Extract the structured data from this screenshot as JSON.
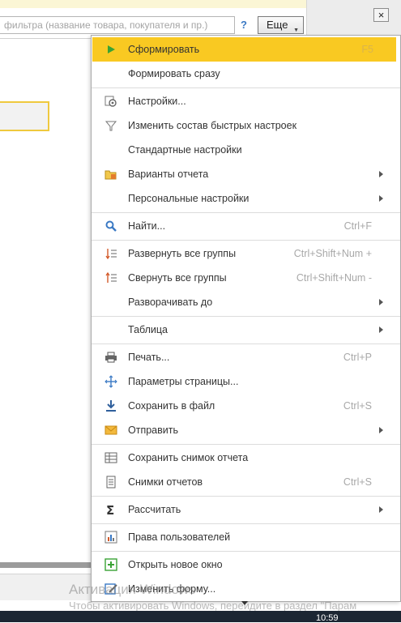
{
  "search": {
    "placeholder": "фильтра (название товара, покупателя и пр.)"
  },
  "toolbar": {
    "help_label": "?",
    "more_label": "Еще",
    "close_label": "×"
  },
  "menu": {
    "items": [
      {
        "label": "Сформировать",
        "shortcut": "F5",
        "icon": "play-icon",
        "highlighted": true
      },
      {
        "label": "Формировать сразу",
        "shortcut": "",
        "icon": ""
      },
      {
        "label": "Настройки...",
        "shortcut": "",
        "icon": "settings-icon"
      },
      {
        "label": "Изменить состав быстрых настроек",
        "shortcut": "",
        "icon": "filter-icon"
      },
      {
        "label": "Стандартные настройки",
        "shortcut": "",
        "icon": ""
      },
      {
        "label": "Варианты отчета",
        "shortcut": "",
        "icon": "folder-icon",
        "submenu": true
      },
      {
        "label": "Персональные настройки",
        "shortcut": "",
        "icon": "",
        "submenu": true
      },
      {
        "label": "Найти...",
        "shortcut": "Ctrl+F",
        "icon": "search-icon"
      },
      {
        "label": "Развернуть все группы",
        "shortcut": "Ctrl+Shift+Num +",
        "icon": "expand-groups-icon"
      },
      {
        "label": "Свернуть все группы",
        "shortcut": "Ctrl+Shift+Num -",
        "icon": "collapse-groups-icon"
      },
      {
        "label": "Разворачивать до",
        "shortcut": "",
        "icon": "",
        "submenu": true
      },
      {
        "label": "Таблица",
        "shortcut": "",
        "icon": "",
        "submenu": true
      },
      {
        "label": "Печать...",
        "shortcut": "Ctrl+P",
        "icon": "printer-icon"
      },
      {
        "label": "Параметры страницы...",
        "shortcut": "",
        "icon": "page-settings-icon"
      },
      {
        "label": "Сохранить в файл",
        "shortcut": "Ctrl+S",
        "icon": "download-icon"
      },
      {
        "label": "Отправить",
        "shortcut": "",
        "icon": "envelope-icon",
        "submenu": true
      },
      {
        "label": "Сохранить снимок отчета",
        "shortcut": "",
        "icon": "table-icon"
      },
      {
        "label": "Снимки отчетов",
        "shortcut": "Ctrl+S",
        "icon": "document-icon"
      },
      {
        "label": "Рассчитать",
        "shortcut": "",
        "icon": "sigma-icon",
        "submenu": true
      },
      {
        "label": "Права пользователей",
        "shortcut": "",
        "icon": "chart-icon"
      },
      {
        "label": "Открыть новое окно",
        "shortcut": "",
        "icon": "new-window-icon"
      },
      {
        "label": "Изменить форму...",
        "shortcut": "",
        "icon": "edit-form-icon"
      }
    ]
  },
  "watermark": {
    "line1": "Активация Windows",
    "line2": "Чтобы активировать Windows, перейдите в раздел \"Парам"
  },
  "taskbar": {
    "time": "10:59"
  },
  "colors": {
    "highlight": "#f9c922",
    "accent_blue": "#3a79c4",
    "play_green": "#3aa335"
  }
}
